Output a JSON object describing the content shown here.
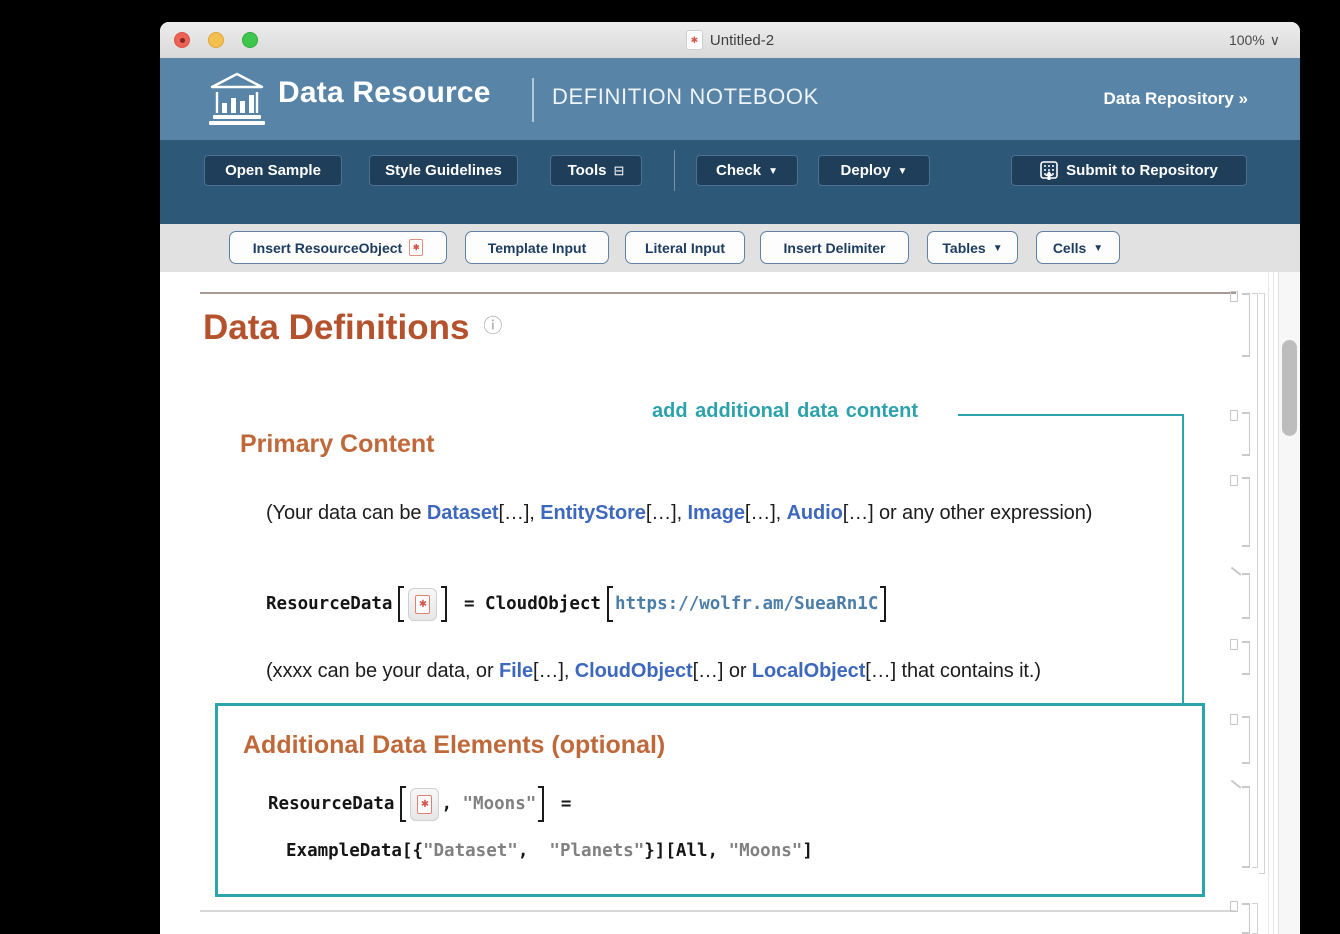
{
  "window": {
    "title": "Untitled-2",
    "zoom_level": "100%"
  },
  "header": {
    "brand": "Data Resource",
    "subtitle": "DEFINITION NOTEBOOK",
    "repository_link": "Data Repository »"
  },
  "toolbar": {
    "open_sample": "Open Sample",
    "style_guidelines": "Style Guidelines",
    "tools": "Tools",
    "check": "Check",
    "deploy": "Deploy",
    "submit": "Submit to Repository"
  },
  "insert_bar": {
    "insert_resource_object": "Insert ResourceObject",
    "template_input": "Template Input",
    "literal_input": "Literal Input",
    "insert_delimiter": "Insert Delimiter",
    "tables": "Tables",
    "cells": "Cells"
  },
  "icons": {
    "dropdown": "▼",
    "tools_window": "⊟",
    "info": "ⓘ",
    "resource_glyph": "✱",
    "titlebar_chevron": "∨"
  },
  "colors": {
    "header_blue": "#5884A8",
    "toolbar_blue": "#2E5878",
    "button_navy": "#1E3E5A",
    "heading_orange": "#B5522E",
    "section_orange": "#BF6839",
    "teal_accent": "#2BA4AD",
    "link_blue": "#3E68BE",
    "url_blue": "#4D7EA8",
    "string_gray": "#808080",
    "resource_red": "#D4574E"
  },
  "content": {
    "page_title": "Data Definitions",
    "annotation": "add additional data content",
    "primary": {
      "heading": "Primary Content",
      "note1": [
        {
          "text": "(Your data can be ",
          "style": "plain"
        },
        {
          "text": "Dataset",
          "style": "link"
        },
        {
          "text": "[…], ",
          "style": "plain"
        },
        {
          "text": "EntityStore",
          "style": "link"
        },
        {
          "text": "[…], ",
          "style": "plain"
        },
        {
          "text": "Image",
          "style": "link"
        },
        {
          "text": "[…], ",
          "style": "plain"
        },
        {
          "text": "Audio",
          "style": "link"
        },
        {
          "text": "[…] or any other expression)",
          "style": "plain"
        }
      ],
      "code1": [
        {
          "text": "ResourceData",
          "style": "kw"
        },
        {
          "style": "lb"
        },
        {
          "style": "robj"
        },
        {
          "style": "rb"
        },
        {
          "text": " = ",
          "style": "kw"
        },
        {
          "text": "CloudObject",
          "style": "kw"
        },
        {
          "style": "lb"
        },
        {
          "text": "https://wolfr.am/SueaRn1C",
          "style": "url"
        },
        {
          "style": "rb"
        }
      ],
      "note2": [
        {
          "text": "(xxxx can be your data, or ",
          "style": "plain"
        },
        {
          "text": "File",
          "style": "link"
        },
        {
          "text": "[…], ",
          "style": "plain"
        },
        {
          "text": "CloudObject",
          "style": "link"
        },
        {
          "text": "[…] or ",
          "style": "plain"
        },
        {
          "text": "LocalObject",
          "style": "link"
        },
        {
          "text": "[…] that contains it.)",
          "style": "plain"
        }
      ]
    },
    "additional": {
      "heading": "Additional Data Elements (optional)",
      "code_line1": [
        {
          "text": "ResourceData",
          "style": "kw"
        },
        {
          "style": "lb"
        },
        {
          "style": "robj"
        },
        {
          "text": ", ",
          "style": "kw"
        },
        {
          "text": "\"Moons\"",
          "style": "str"
        },
        {
          "style": "rb"
        },
        {
          "text": " =",
          "style": "kw"
        }
      ],
      "code_line2": [
        {
          "text": "ExampleData",
          "style": "kw"
        },
        {
          "text": "[{",
          "style": "kw"
        },
        {
          "text": "\"Dataset\"",
          "style": "str"
        },
        {
          "text": ",  ",
          "style": "kw"
        },
        {
          "text": "\"Planets\"",
          "style": "str"
        },
        {
          "text": "}]",
          "style": "kw"
        },
        {
          "text": "[",
          "style": "kw"
        },
        {
          "text": "All",
          "style": "kw"
        },
        {
          "text": ", ",
          "style": "kw"
        },
        {
          "text": "\"Moons\"",
          "style": "str"
        },
        {
          "text": "]",
          "style": "kw"
        }
      ]
    }
  }
}
